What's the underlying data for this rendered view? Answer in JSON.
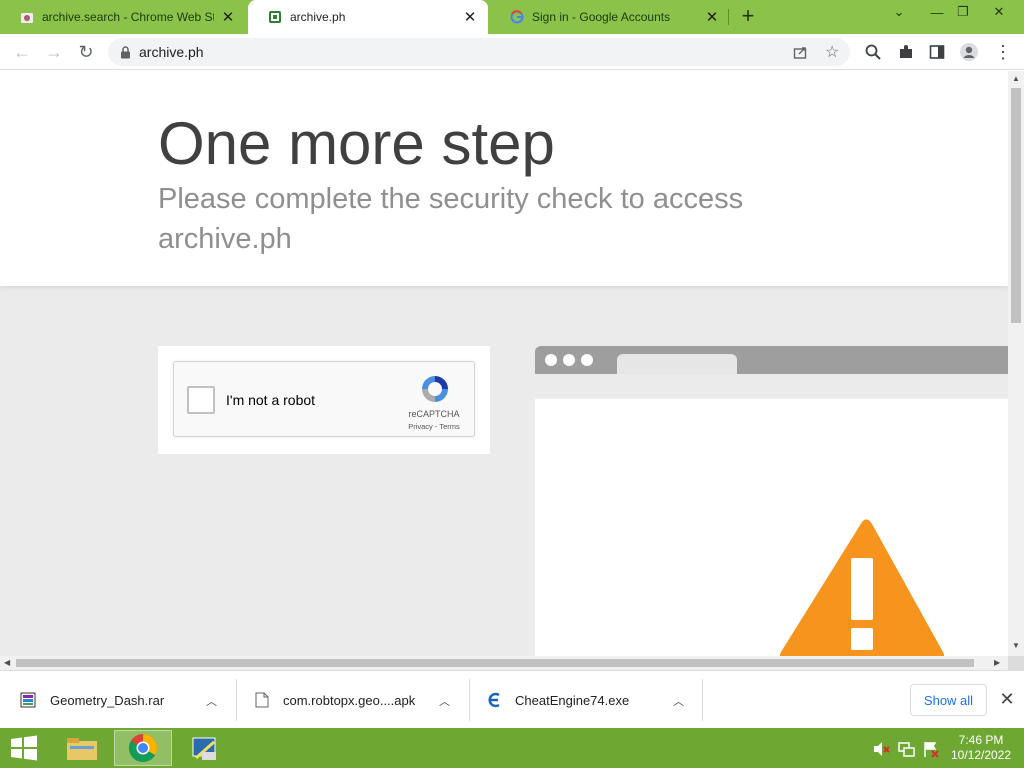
{
  "tabs": [
    {
      "title": "archive.search - Chrome Web Store",
      "active": false
    },
    {
      "title": "archive.ph",
      "active": true
    },
    {
      "title": "Sign in - Google Accounts",
      "active": false
    }
  ],
  "address_bar": {
    "url": "archive.ph"
  },
  "page": {
    "heading": "One more step",
    "subheading": "Please complete the security check to access archive.ph"
  },
  "captcha": {
    "checkbox_label": "I'm not a robot",
    "brand": "reCAPTCHA",
    "links": "Privacy - Terms"
  },
  "downloads": [
    {
      "name": "Geometry_Dash.rar"
    },
    {
      "name": "com.robtopx.geo....apk"
    },
    {
      "name": "CheatEngine74.exe"
    }
  ],
  "download_shelf": {
    "show_all_label": "Show all"
  },
  "taskbar": {
    "time": "7:46 PM",
    "date": "10/12/2022"
  },
  "colors": {
    "tab_strip": "#8bc34a",
    "taskbar": "#6ea832",
    "warning": "#f7941d"
  }
}
